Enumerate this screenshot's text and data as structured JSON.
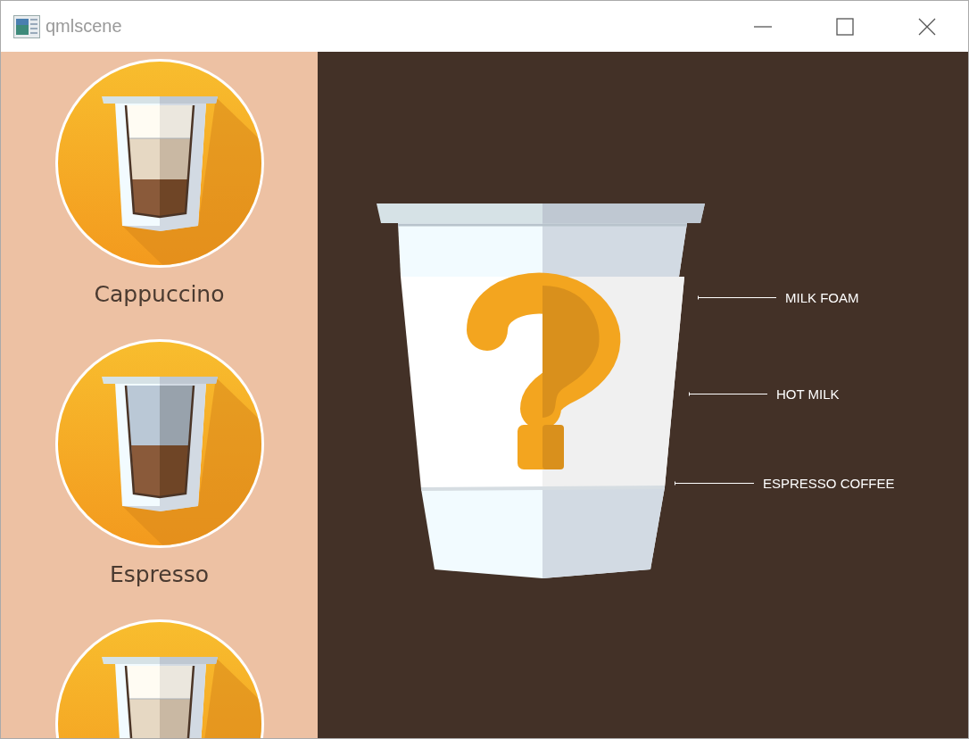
{
  "window": {
    "title": "qmlscene"
  },
  "drinks": [
    {
      "label": "Cappuccino",
      "kind": "foam"
    },
    {
      "label": "Espresso",
      "kind": "plain"
    },
    {
      "kind": "foam"
    }
  ],
  "annotations": [
    {
      "label": "MILK FOAM"
    },
    {
      "label": "HOT MILK"
    },
    {
      "label": "ESPRESSO COFFEE"
    }
  ]
}
